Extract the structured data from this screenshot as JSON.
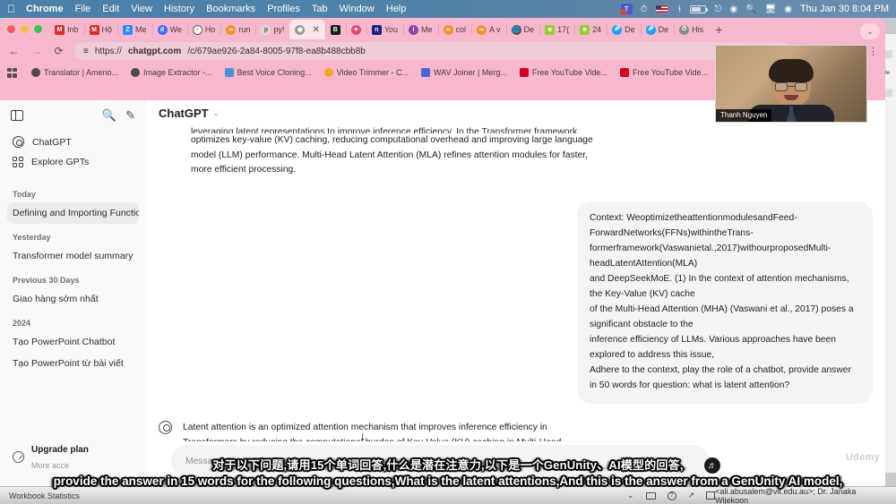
{
  "menubar": {
    "apple": "apple-logo",
    "items": [
      "Chrome",
      "File",
      "Edit",
      "View",
      "History",
      "Bookmarks",
      "Profiles",
      "Tab",
      "Window",
      "Help"
    ],
    "active_app": "Chrome",
    "clock": "Thu Jan 30  8:04 PM",
    "status_icons": [
      "teams-icon",
      "timemachine-icon",
      "us-flag-icon",
      "bluetooth-icon",
      "battery-icon",
      "wifi-icon",
      "control-center-icon",
      "spotlight-search-icon",
      "display-icon",
      "user-account-icon"
    ]
  },
  "browser": {
    "tabs": [
      {
        "label": "Inb",
        "favicon": "gmail-icon",
        "color": "#d93025",
        "active": false
      },
      {
        "label": "Hộ",
        "favicon": "gmail-icon",
        "color": "#d93025",
        "active": false
      },
      {
        "label": "Me",
        "favicon": "zoom-icon",
        "color": "#2d8cff",
        "active": false
      },
      {
        "label": "We",
        "favicon": "descript-icon",
        "color": "#3d6eff",
        "active": false
      },
      {
        "label": "Ho",
        "favicon": "notion-icon",
        "color": "#444",
        "active": false
      },
      {
        "label": "run",
        "favicon": "chain-icon",
        "color": "#f0932b",
        "active": false
      },
      {
        "label": "py!",
        "favicon": "python-icon",
        "color": "#c0c0c0",
        "active": false
      },
      {
        "label": "",
        "favicon": "chatgpt-icon",
        "color": "#888",
        "active": true
      },
      {
        "label": "",
        "favicon": "bkv-icon",
        "color": "#1a1a1a",
        "active": false
      },
      {
        "label": "",
        "favicon": "rocket-icon",
        "color": "#e0457b",
        "active": false
      },
      {
        "label": "You",
        "favicon": "notion-blue-icon",
        "color": "#1a237e",
        "active": false
      },
      {
        "label": "Me",
        "favicon": "info-icon",
        "color": "#8e44ad",
        "active": false
      },
      {
        "label": "col",
        "favicon": "chain-icon",
        "color": "#f0932b",
        "active": false
      },
      {
        "label": "A v",
        "favicon": "chain-icon",
        "color": "#f0932b",
        "active": false
      },
      {
        "label": "De",
        "favicon": "globe-icon",
        "color": "#555",
        "active": false
      },
      {
        "label": "17(",
        "favicon": "green-icon",
        "color": "#9acd32",
        "active": false
      },
      {
        "label": "24",
        "favicon": "green-icon",
        "color": "#9acd32",
        "active": false
      },
      {
        "label": "De",
        "favicon": "twitter-icon",
        "color": "#1da1f2",
        "active": false
      },
      {
        "label": "De",
        "favicon": "twitter-icon",
        "color": "#1da1f2",
        "active": false
      },
      {
        "label": "His",
        "favicon": "history-icon",
        "color": "#666",
        "active": false
      }
    ],
    "new_tab_label": "+",
    "tab_list_chevron": "⌄",
    "nav": {
      "back": "←",
      "forward": "→",
      "reload": "⟳"
    },
    "url": {
      "lock_icon": "site-settings-icon",
      "scheme": "https://",
      "host": "chatgpt.com",
      "path": "/c/679ae926-2a84-8005-97f8-ea8b488cbb8b"
    },
    "omnibox_right_icons": [
      "share-icon",
      "bookmark-star-icon",
      "extensions-icon",
      "profile-avatar"
    ],
    "bookmarks": [
      {
        "label": "Translator | Ameno...",
        "icon": "globe-icon",
        "color": "#4a4a4a"
      },
      {
        "label": "Image Extractor -...",
        "icon": "globe-icon",
        "color": "#4a4a4a"
      },
      {
        "label": "Best Voice Cloning...",
        "icon": "triangle-icon",
        "color": "#4a90d9"
      },
      {
        "label": "Video Trimmer - C...",
        "icon": "dots-icon",
        "color": "#f5a623"
      },
      {
        "label": "WAV Joiner | Merg...",
        "icon": "bolt-icon",
        "color": "#4a63d9"
      },
      {
        "label": "Free YouTube Vide...",
        "icon": "download-icon",
        "color": "#d0021b"
      },
      {
        "label": "Free YouTube Vide...",
        "icon": "download-icon",
        "color": "#d0021b"
      }
    ],
    "apps_grid_label": "apps-grid-icon"
  },
  "chatgpt": {
    "sidebar": {
      "toggle_icon": "sidebar-toggle-icon",
      "search_icon": "search-icon",
      "new_chat_icon": "new-chat-icon",
      "nav": [
        {
          "label": "ChatGPT",
          "icon": "chatgpt-logo-icon"
        },
        {
          "label": "Explore GPTs",
          "icon": "grid-icon"
        }
      ],
      "sections": [
        {
          "header": "Today",
          "chats": [
            {
              "label": "Defining and Importing Functio",
              "selected": true,
              "menu": "···"
            }
          ]
        },
        {
          "header": "Yesterday",
          "chats": [
            {
              "label": "Transformer model summary",
              "selected": false
            }
          ]
        },
        {
          "header": "Previous 30 Days",
          "chats": [
            {
              "label": "Giao hàng sớm nhất",
              "selected": false
            }
          ]
        },
        {
          "header": "2024",
          "chats": [
            {
              "label": "Tạo PowerPoint Chatbot",
              "selected": false
            },
            {
              "label": "Tạo PowerPoint từ bài viết",
              "selected": false
            }
          ]
        }
      ],
      "upgrade": {
        "title": "Upgrade plan",
        "subtitle": "More acce",
        "icon": "upgrade-icon"
      }
    },
    "header": {
      "title": "ChatGPT",
      "chevron": "⌄"
    },
    "messages": {
      "assistant_prev_clipped": "leveraging latent representations to improve inference efficiency. In the Transformer framework,",
      "assistant_prev": "optimizes key-value (KV) caching, reducing computational overhead and improving large language model (LLM) performance. Multi-Head Latent Attention (MLA) refines attention modules for faster, more efficient processing.",
      "user": "Context: WeoptimizetheattentionmodulesandFeed-\nForwardNetworks(FFNs)withintheTrans-\nformerframework(Vaswanietal.,2017)withourproposedMulti-\nheadLatentAttention(MLA)\nand DeepSeekMoE. (1) In the context of attention mechanisms, the Key-Value (KV) cache\nof the Multi-Head Attention (MHA) (Vaswani et al., 2017) poses a significant obstacle to the\ninference efficiency of LLMs. Various approaches have been explored to address this issue,\nAdhere to the context, play the role of a chatbot, provide answer in 50 words for question: what is latent attention?",
      "assistant": "Latent attention is an optimized attention mechanism that improves inference efficiency in Transformers by reducing the computational burden of Key-Value (KV) caching in Multi-Head Attention (MHA). Multi-Head Latent Attention (MLA) refines attention modules, enhancing efficiency and scalability in large language models (LLMs) like DeepSeekMoE.",
      "assistant_avatar": "chatgpt-logo-icon"
    },
    "composer": {
      "placeholder": "Message ChatGPT"
    },
    "watermark": "Udemy"
  },
  "video_overlay": {
    "name": "Thanh Nguyen"
  },
  "subtitles": {
    "line_cn": "对于以下问题,请用15个单词回答,什么是潜在注意力,以下是一个GenUnity、AI模型的回答,",
    "line_en": "provide the answer in 15 words for the following questions,What is the latent attentions,And this is the answer from a GenUnity AI model,",
    "mic_icon": "audio-wave-icon"
  },
  "taskbar": {
    "left_label": "Workbook Statistics",
    "right_label": "<ali.abusalem@vit.edu.au>; Dr. Janaka Wijekoon",
    "icons": [
      "chevron-down-icon",
      "keyboard-icon",
      "help-circle-icon",
      "share-icon",
      "fullscreen-icon"
    ]
  },
  "colors": {
    "chrome_pink": "#f7b8cd",
    "menubar_blue": "#4f82a9",
    "accent_gray": "#f4f4f4",
    "taskbar_gray": "#dcdcdc"
  }
}
